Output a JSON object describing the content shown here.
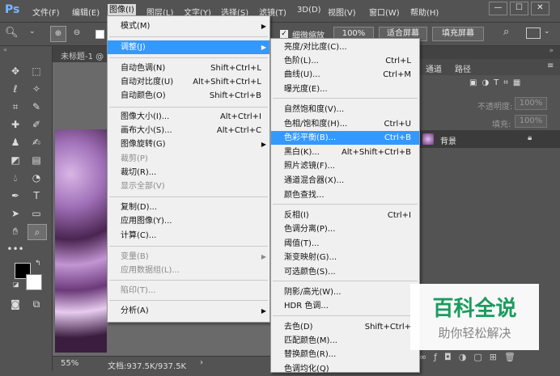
{
  "menubar": {
    "logo": "Ps",
    "items": [
      "文件(F)",
      "编辑(E)",
      "图像(I)",
      "图层(L)",
      "文字(Y)",
      "选择(S)",
      "滤镜(T)",
      "3D(D)",
      "视图(V)",
      "窗口(W)",
      "帮助(H)"
    ],
    "window_buttons": [
      "—",
      "☐",
      "✕"
    ]
  },
  "options": {
    "checkbox_label": "细微缩放",
    "zoom_value": "100%",
    "fit_screen": "适合屏幕",
    "fill_screen": "填充屏幕"
  },
  "document": {
    "tab_title": "未标题-1 @",
    "zoom": "55%",
    "doc_info": "文档:937.5K/937.5K"
  },
  "panel": {
    "tabs": [
      "通道",
      "路径"
    ],
    "opacity_label": "不透明度:",
    "opacity_value": "100%",
    "fill_label": "填充:",
    "fill_value": "100%",
    "layer_name": "背景"
  },
  "image_menu": {
    "items": [
      {
        "label": "模式(M)",
        "shortcut": "",
        "submenu": true,
        "disabled": false
      },
      {
        "label": "调整(J)",
        "shortcut": "",
        "submenu": true,
        "disabled": false,
        "highlighted": true
      },
      {
        "label": "自动色调(N)",
        "shortcut": "Shift+Ctrl+L"
      },
      {
        "label": "自动对比度(U)",
        "shortcut": "Alt+Shift+Ctrl+L"
      },
      {
        "label": "自动颜色(O)",
        "shortcut": "Shift+Ctrl+B"
      },
      {
        "label": "图像大小(I)...",
        "shortcut": "Alt+Ctrl+I"
      },
      {
        "label": "画布大小(S)...",
        "shortcut": "Alt+Ctrl+C"
      },
      {
        "label": "图像旋转(G)",
        "shortcut": "",
        "submenu": true
      },
      {
        "label": "裁剪(P)",
        "shortcut": "",
        "disabled": true
      },
      {
        "label": "裁切(R)...",
        "shortcut": ""
      },
      {
        "label": "显示全部(V)",
        "shortcut": "",
        "disabled": true
      },
      {
        "label": "复制(D)...",
        "shortcut": ""
      },
      {
        "label": "应用图像(Y)...",
        "shortcut": ""
      },
      {
        "label": "计算(C)...",
        "shortcut": ""
      },
      {
        "label": "变量(B)",
        "shortcut": "",
        "submenu": true,
        "disabled": true
      },
      {
        "label": "应用数据组(L)...",
        "shortcut": "",
        "disabled": true
      },
      {
        "label": "陷印(T)...",
        "shortcut": "",
        "disabled": true
      },
      {
        "label": "分析(A)",
        "shortcut": "",
        "submenu": true
      }
    ]
  },
  "adjust_menu": {
    "items": [
      {
        "label": "亮度/对比度(C)...",
        "shortcut": ""
      },
      {
        "label": "色阶(L)...",
        "shortcut": "Ctrl+L"
      },
      {
        "label": "曲线(U)...",
        "shortcut": "Ctrl+M"
      },
      {
        "label": "曝光度(E)...",
        "shortcut": ""
      },
      {
        "label": "自然饱和度(V)...",
        "shortcut": ""
      },
      {
        "label": "色相/饱和度(H)...",
        "shortcut": "Ctrl+U"
      },
      {
        "label": "色彩平衡(B)...",
        "shortcut": "Ctrl+B",
        "highlighted": true
      },
      {
        "label": "黑白(K)...",
        "shortcut": "Alt+Shift+Ctrl+B"
      },
      {
        "label": "照片滤镜(F)...",
        "shortcut": ""
      },
      {
        "label": "通道混合器(X)...",
        "shortcut": ""
      },
      {
        "label": "颜色查找...",
        "shortcut": ""
      },
      {
        "label": "反相(I)",
        "shortcut": "Ctrl+I"
      },
      {
        "label": "色调分离(P)...",
        "shortcut": ""
      },
      {
        "label": "阈值(T)...",
        "shortcut": ""
      },
      {
        "label": "渐变映射(G)...",
        "shortcut": ""
      },
      {
        "label": "可选颜色(S)...",
        "shortcut": ""
      },
      {
        "label": "阴影/高光(W)...",
        "shortcut": ""
      },
      {
        "label": "HDR 色调...",
        "shortcut": ""
      },
      {
        "label": "去色(D)",
        "shortcut": "Shift+Ctrl+"
      },
      {
        "label": "匹配颜色(M)...",
        "shortcut": ""
      },
      {
        "label": "替换颜色(R)...",
        "shortcut": ""
      },
      {
        "label": "色调均化(Q)",
        "shortcut": ""
      }
    ]
  },
  "watermark": {
    "title": "百科全说",
    "subtitle": "助你轻松解决"
  }
}
